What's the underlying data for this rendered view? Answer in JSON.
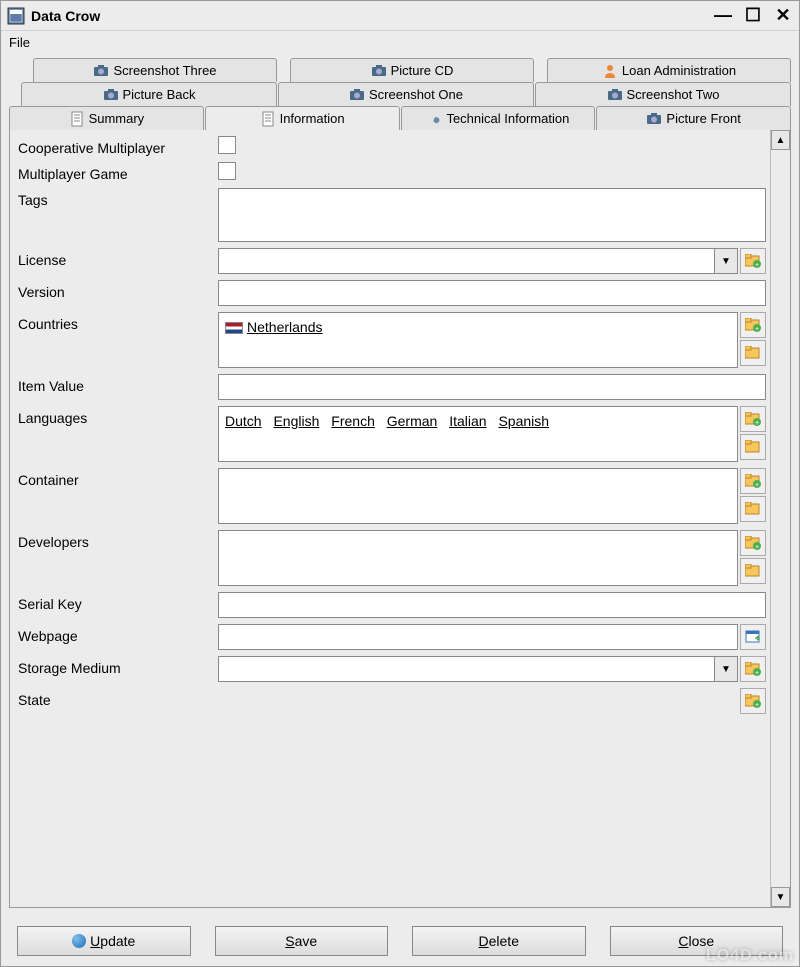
{
  "window": {
    "title": "Data Crow"
  },
  "menu": {
    "file": "File"
  },
  "tabs": {
    "row1": [
      {
        "label": "Screenshot Three",
        "icon": "camera"
      },
      {
        "label": "Picture CD",
        "icon": "camera"
      },
      {
        "label": "Loan Administration",
        "icon": "person"
      }
    ],
    "row2": [
      {
        "label": "Picture Back",
        "icon": "camera"
      },
      {
        "label": "Screenshot One",
        "icon": "camera"
      },
      {
        "label": "Screenshot Two",
        "icon": "camera"
      }
    ],
    "row3": [
      {
        "label": "Summary",
        "icon": "document"
      },
      {
        "label": "Information",
        "icon": "document",
        "active": true
      },
      {
        "label": "Technical Information",
        "icon": "wrench"
      },
      {
        "label": "Picture Front",
        "icon": "camera"
      }
    ]
  },
  "form": {
    "coop_multi": {
      "label": "Cooperative Multiplayer",
      "checked": false
    },
    "multi_game": {
      "label": "Multiplayer Game",
      "checked": false
    },
    "tags": {
      "label": "Tags",
      "value": ""
    },
    "license": {
      "label": "License",
      "value": ""
    },
    "version": {
      "label": "Version",
      "value": ""
    },
    "countries": {
      "label": "Countries",
      "items": [
        "Netherlands"
      ]
    },
    "item_value": {
      "label": "Item Value",
      "value": ""
    },
    "languages": {
      "label": "Languages",
      "items": [
        "Dutch",
        "English",
        "French",
        "German",
        "Italian",
        "Spanish"
      ]
    },
    "container": {
      "label": "Container",
      "value": ""
    },
    "developers": {
      "label": "Developers",
      "value": ""
    },
    "serial_key": {
      "label": "Serial Key",
      "value": ""
    },
    "webpage": {
      "label": "Webpage",
      "value": ""
    },
    "storage_medium": {
      "label": "Storage Medium",
      "value": ""
    },
    "state": {
      "label": "State",
      "value": ""
    }
  },
  "buttons": {
    "update": "Update",
    "save": "Save",
    "delete": "Delete",
    "close": "Close"
  },
  "watermark": "LO4D.com"
}
